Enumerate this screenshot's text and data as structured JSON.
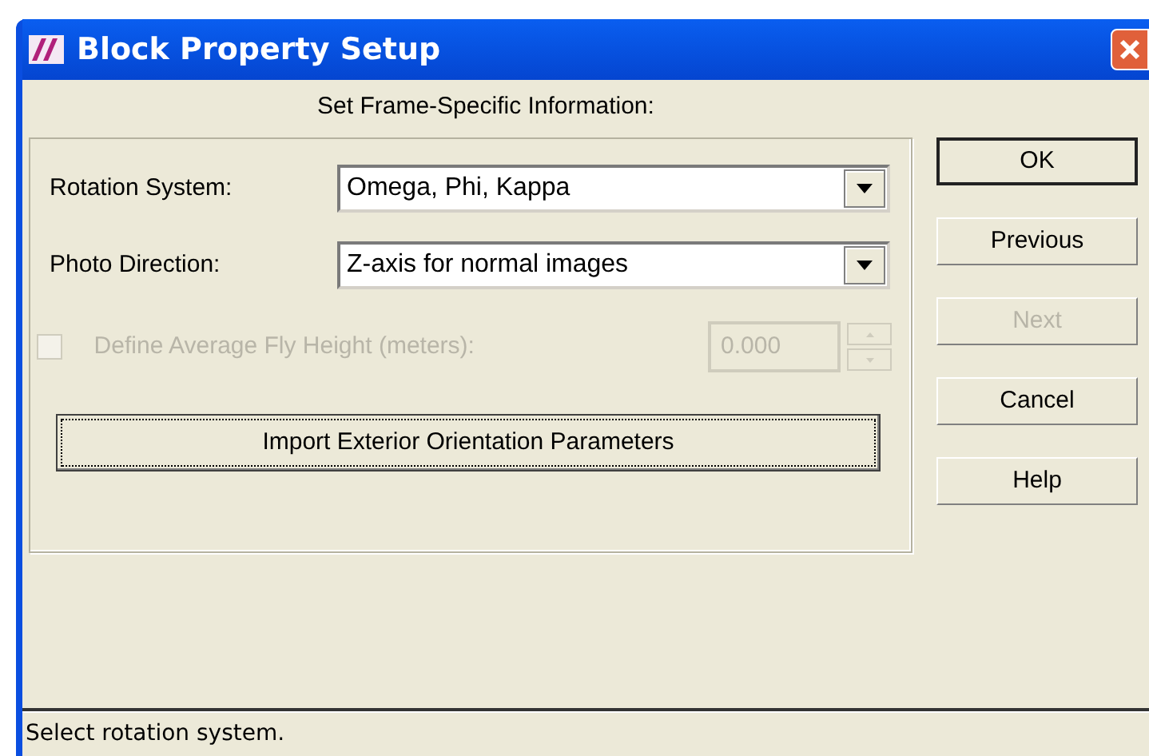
{
  "window": {
    "title": "Block Property Setup"
  },
  "heading": "Set Frame-Specific Information:",
  "fields": [
    {
      "label": "Rotation System:",
      "value": "Omega, Phi, Kappa"
    },
    {
      "label": "Photo Direction:",
      "value": "Z-axis for normal images"
    }
  ],
  "fly_height": {
    "label": "Define Average Fly Height (meters):",
    "checked": false,
    "disabled": true,
    "value": "0.000"
  },
  "import_button": "Import Exterior Orientation Parameters",
  "buttons": [
    {
      "label": "OK",
      "disabled": false,
      "default": true
    },
    {
      "label": "Previous",
      "disabled": false,
      "default": false
    },
    {
      "label": "Next",
      "disabled": true,
      "default": false
    },
    {
      "label": "Cancel",
      "disabled": false,
      "default": false
    },
    {
      "label": "Help",
      "disabled": false,
      "default": false
    }
  ],
  "status_bar": "Select rotation system."
}
